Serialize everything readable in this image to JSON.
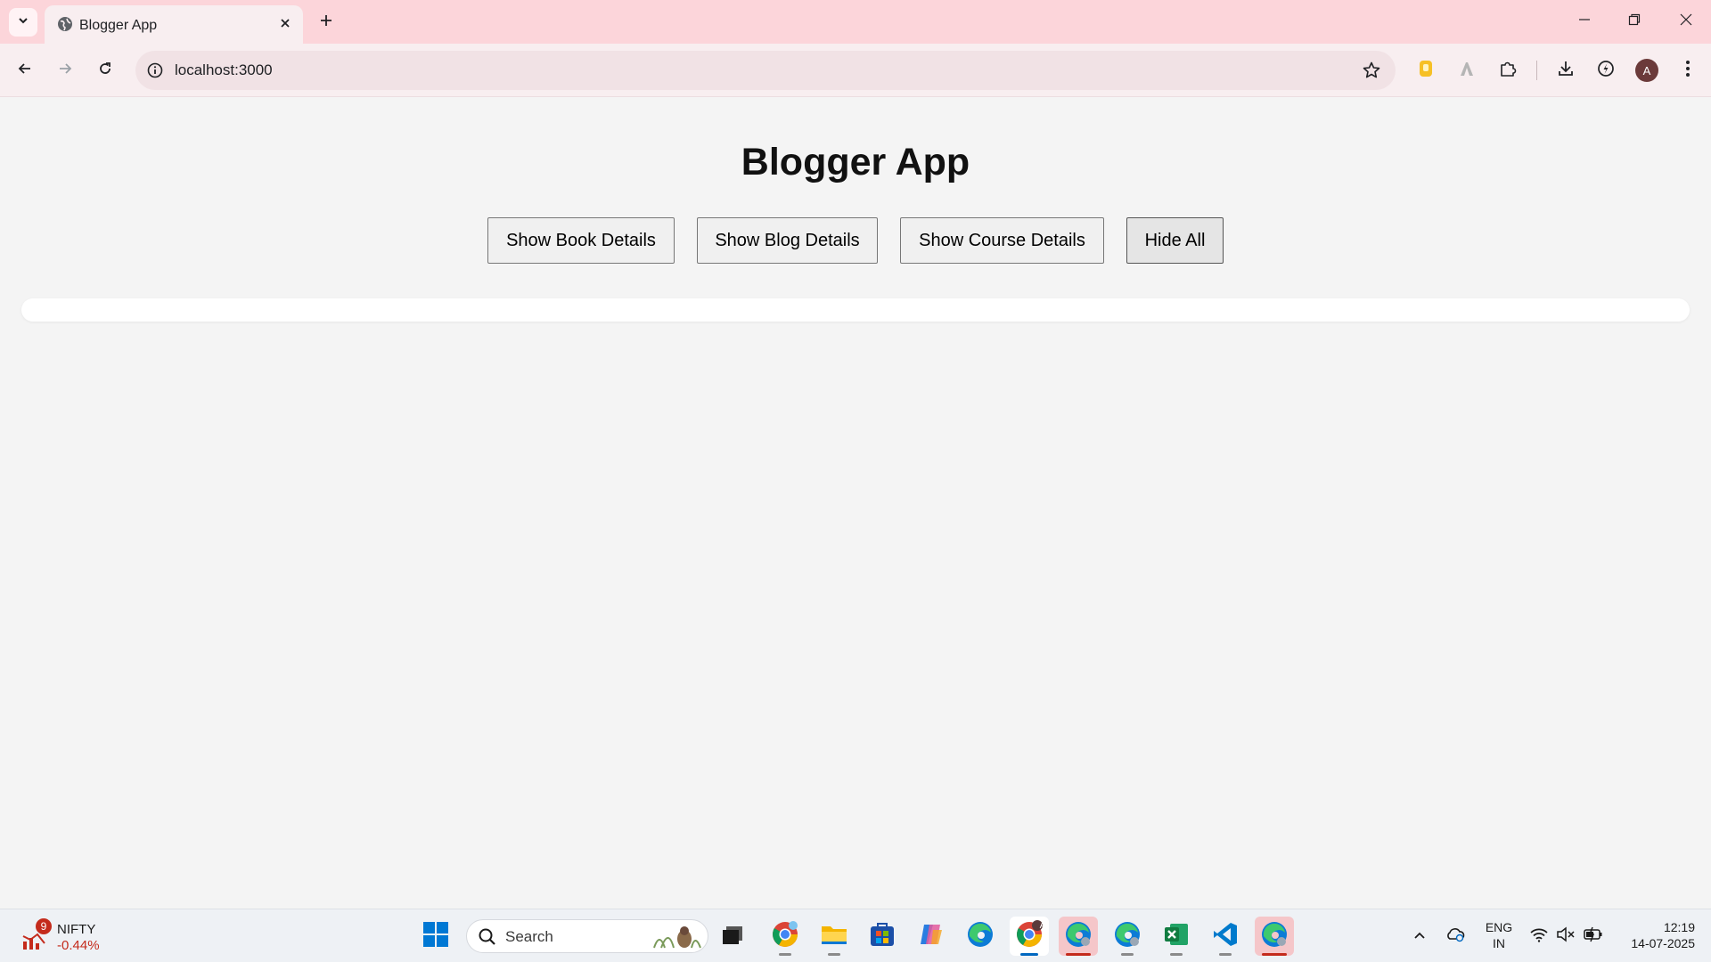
{
  "browser": {
    "tab_title": "Blogger App",
    "url": "localhost:3000",
    "profile_initial": "A"
  },
  "page": {
    "title": "Blogger App",
    "buttons": {
      "book": "Show Book Details",
      "blog": "Show Blog Details",
      "course": "Show Course Details",
      "hide": "Hide All"
    }
  },
  "taskbar": {
    "widget": {
      "badge": "9",
      "name": "NIFTY",
      "change": "-0.44%"
    },
    "search_placeholder": "Search",
    "lang_line1": "ENG",
    "lang_line2": "IN",
    "time": "12:19",
    "date": "14-07-2025",
    "chrome_badge": "A"
  },
  "colors": {
    "tabbar": "#fcd5da",
    "toolbar": "#f8eef0",
    "page_bg": "#f4f4f4",
    "negative": "#c42b1c",
    "accent": "#0067c0"
  }
}
